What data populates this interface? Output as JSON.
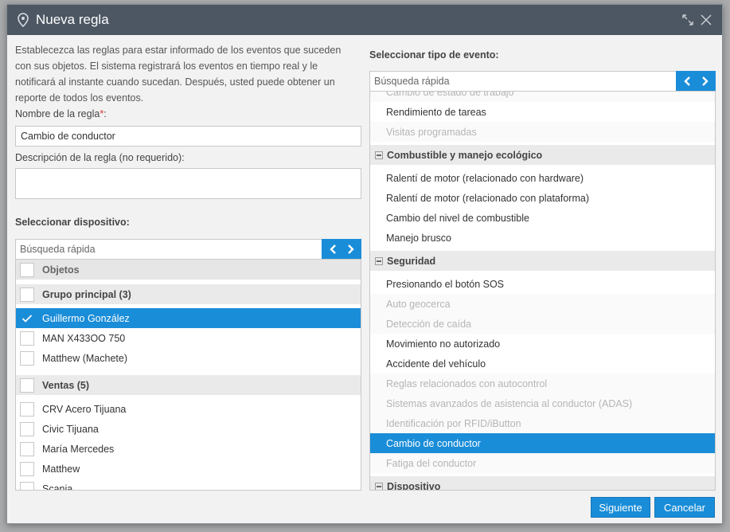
{
  "dialog": {
    "title": "Nueva regla",
    "intro": "Establecezca las reglas para estar informado de los eventos que suceden con sus objetos. El sistema registrará los eventos en tiempo real y le notificará al instante cuando sucedan. Después, usted puede obtener un reporte de todos los eventos."
  },
  "form": {
    "rule_name_label": "Nombre de la regla",
    "required_mark": "*",
    "colon": ":",
    "rule_name_value": "Cambio de conductor",
    "description_label": "Descripción de la regla (no requerido):",
    "description_value": ""
  },
  "device_selector": {
    "title": "Seleccionar dispositivo:",
    "search_placeholder": "Búsqueda rápida",
    "header": "Objetos",
    "groups": [
      {
        "label": "Grupo principal (3)",
        "items": [
          {
            "label": "Guillermo González",
            "checked": true
          },
          {
            "label": "MAN X433OO 750",
            "checked": false
          },
          {
            "label": "Matthew (Machete)",
            "checked": false
          }
        ]
      },
      {
        "label": "Ventas (5)",
        "items": [
          {
            "label": "CRV Acero Tijuana",
            "checked": false
          },
          {
            "label": "Civic Tijuana",
            "checked": false
          },
          {
            "label": "María Mercedes",
            "checked": false
          },
          {
            "label": "Matthew",
            "checked": false
          },
          {
            "label": "Scania",
            "checked": false
          }
        ]
      }
    ]
  },
  "event_selector": {
    "title": "Seleccionar tipo de evento:",
    "search_placeholder": "Búsqueda rápida",
    "rows": [
      {
        "kind": "item",
        "label": "Cambio de estado de trabajo",
        "enabled": false
      },
      {
        "kind": "item",
        "label": "Rendimiento de tareas",
        "enabled": true
      },
      {
        "kind": "item",
        "label": "Visitas programadas",
        "enabled": false
      },
      {
        "kind": "group",
        "label": "Combustible y manejo ecológico"
      },
      {
        "kind": "item",
        "label": "Ralentí de motor (relacionado con hardware)",
        "enabled": true
      },
      {
        "kind": "item",
        "label": "Ralentí de motor (relacionado con plataforma)",
        "enabled": true
      },
      {
        "kind": "item",
        "label": "Cambio del nivel de combustible",
        "enabled": true
      },
      {
        "kind": "item",
        "label": "Manejo brusco",
        "enabled": true
      },
      {
        "kind": "group",
        "label": "Seguridad"
      },
      {
        "kind": "item",
        "label": "Presionando el botón SOS",
        "enabled": true
      },
      {
        "kind": "item",
        "label": "Auto geocerca",
        "enabled": false
      },
      {
        "kind": "item",
        "label": "Detección de caída",
        "enabled": false
      },
      {
        "kind": "item",
        "label": "Movimiento no autorizado",
        "enabled": true
      },
      {
        "kind": "item",
        "label": "Accidente del vehículo",
        "enabled": true
      },
      {
        "kind": "item",
        "label": "Reglas relacionados con autocontrol",
        "enabled": false
      },
      {
        "kind": "item",
        "label": "Sistemas avanzados de asistencia al conductor (ADAS)",
        "enabled": false
      },
      {
        "kind": "item",
        "label": "Identificación por RFID/iButton",
        "enabled": false
      },
      {
        "kind": "item",
        "label": "Cambio de conductor",
        "enabled": true,
        "selected": true
      },
      {
        "kind": "item",
        "label": "Fatiga del conductor",
        "enabled": false
      },
      {
        "kind": "group",
        "label": "Dispositivo"
      }
    ]
  },
  "buttons": {
    "next": "Siguiente",
    "cancel": "Cancelar"
  },
  "icons": {
    "title": "map-pin-icon",
    "expand": "expand-icon",
    "close": "close-icon",
    "prev": "chevron-left-icon",
    "next": "chevron-right-icon",
    "check": "checkmark-icon",
    "collapse": "minus-icon"
  },
  "colors": {
    "titlebar": "#4d5763",
    "accent": "#1a8dd8",
    "required": "#d9342b"
  }
}
